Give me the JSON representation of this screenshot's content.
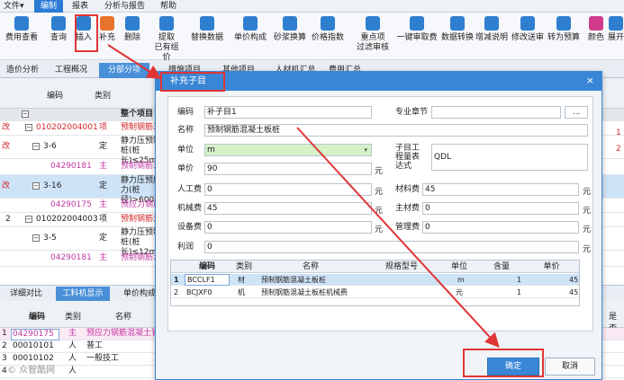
{
  "menubar": {
    "items": [
      "文件▾",
      "编制",
      "报表",
      "分析与报告",
      "帮助"
    ],
    "active_index": 1
  },
  "ribbon": {
    "tools": [
      {
        "label": "费用查看",
        "sub": "",
        "icon": "money-view-icon",
        "color": "#2f7fd0"
      },
      {
        "label": "查询",
        "sub": "",
        "icon": "search-icon",
        "color": "#2f7fd0"
      },
      {
        "label": "插入",
        "sub": "",
        "icon": "insert-icon",
        "color": "#2f7fd0"
      },
      {
        "label": "补充",
        "sub": "",
        "icon": "supplement-icon",
        "color": "#e8732a"
      },
      {
        "label": "删除",
        "sub": "",
        "icon": "delete-icon",
        "color": "#2f7fd0"
      },
      {
        "label": "提取",
        "sub": "已有组价",
        "icon": "extract-icon",
        "color": "#2f7fd0"
      },
      {
        "label": "替换数据",
        "sub": "",
        "icon": "replace-icon",
        "color": "#2f7fd0"
      },
      {
        "label": "单价构成",
        "sub": "",
        "icon": "price-icon",
        "color": "#2f7fd0"
      },
      {
        "label": "砂浆换算",
        "sub": "",
        "icon": "mortar-icon",
        "color": "#2f7fd0"
      },
      {
        "label": "价格指数",
        "sub": "",
        "icon": "index-icon",
        "color": "#2f7fd0"
      },
      {
        "label": "重点项",
        "sub": "过滤审核",
        "icon": "filter-icon",
        "color": "#2f7fd0"
      },
      {
        "label": "一键审取费",
        "sub": "",
        "icon": "fee-icon",
        "color": "#2f7fd0"
      },
      {
        "label": "数据转换",
        "sub": "",
        "icon": "convert-icon",
        "color": "#2f7fd0"
      },
      {
        "label": "增减说明",
        "sub": "",
        "icon": "note-icon",
        "color": "#2f7fd0"
      },
      {
        "label": "修改送审",
        "sub": "",
        "icon": "edit-icon",
        "color": "#2f7fd0"
      },
      {
        "label": "转为预算",
        "sub": "",
        "icon": "budget-icon",
        "color": "#2f7fd0"
      },
      {
        "label": "颜色",
        "sub": "",
        "icon": "color-icon",
        "color": "#d13c8a"
      },
      {
        "label": "展开",
        "sub": "",
        "icon": "expand-icon",
        "color": "#2f7fd0"
      }
    ]
  },
  "tabs": [
    "造价分析",
    "工程概况",
    "分部分项",
    "措施项目",
    "其他项目",
    "人材机汇总",
    "费用汇总"
  ],
  "grid": {
    "headers": [
      "编码",
      "类别"
    ],
    "rows": [
      {
        "mark": "",
        "code": "",
        "type": "",
        "name": "整个项目"
      },
      {
        "mark": "改",
        "code": "010202004001",
        "type": "项",
        "name": "预制钢筋混凝"
      },
      {
        "mark": "改",
        "code": "3-6",
        "type": "定",
        "name": "静力压预制桩(桩长)≤25m"
      },
      {
        "mark": "",
        "code": "04290181",
        "type": "主",
        "name": "预制钢筋混凝"
      },
      {
        "mark": "改",
        "code": "3-16",
        "type": "定",
        "name": "静力压预应力(桩径)>600"
      },
      {
        "mark": "",
        "code": "04290175",
        "type": "主",
        "name": "预应力钢筋混"
      },
      {
        "mark": "2",
        "code": "010202004003",
        "type": "项",
        "name": "预制钢筋混凝"
      },
      {
        "mark": "",
        "code": "3-5",
        "type": "定",
        "name": "静力压预制桩(桩长)≤12m"
      },
      {
        "mark": "",
        "code": "04290181",
        "type": "主",
        "name": "预制钢筋混凝"
      }
    ],
    "right_marks": [
      "1",
      "2"
    ]
  },
  "bottom_tabs": [
    "详细对比",
    "工料机显示",
    "单价构成"
  ],
  "bottom_grid": {
    "headers": [
      "编码",
      "类别",
      "名称",
      "是否"
    ],
    "rows": [
      {
        "idx": "1",
        "code": "04290175",
        "type": "主",
        "name": "预应力钢筋混凝土管桩"
      },
      {
        "idx": "2",
        "code": "00010101",
        "type": "人",
        "name": "普工"
      },
      {
        "idx": "3",
        "code": "00010102",
        "type": "人",
        "name": "一般技工"
      },
      {
        "idx": "4",
        "code": "",
        "type": "人",
        "name": ""
      }
    ]
  },
  "dialog": {
    "title": "补充子目",
    "close": "×",
    "fields": {
      "code_label": "编码",
      "code_value": "补子目1",
      "chapter_label": "专业章节",
      "chapter_value": "",
      "browse": "...",
      "name_label": "名称",
      "name_value": "预制钢筋混凝土板桩",
      "unit_label": "单位",
      "unit_value": "m",
      "qty_expr_label": "子目工程量表达式",
      "qty_expr_value": "QDL",
      "price_label": "单价",
      "price_value": "90",
      "yuan": "元",
      "labor_label": "人工费",
      "labor_value": "0",
      "material_label": "材料费",
      "material_value": "45",
      "machine_label": "机械费",
      "machine_value": "45",
      "main_label": "主材费",
      "main_value": "0",
      "equip_label": "设备费",
      "equip_value": "0",
      "mgmt_label": "管理费",
      "mgmt_value": "0",
      "profit_label": "利润",
      "profit_value": "0"
    },
    "grid": {
      "headers": [
        "编码",
        "类别",
        "名称",
        "规格型号",
        "单位",
        "含量",
        "单价"
      ],
      "rows": [
        {
          "idx": "1",
          "code": "BCCLF1",
          "type": "材",
          "name": "预制钢筋混凝土板桩",
          "spec": "",
          "unit": "m",
          "qty": "1",
          "price": "45"
        },
        {
          "idx": "2",
          "code": "BCJXF0",
          "type": "机",
          "name": "预制钢筋混凝土板桩机械费",
          "spec": "",
          "unit": "元",
          "qty": "1",
          "price": "45"
        }
      ]
    },
    "ok": "确定",
    "cancel": "取消"
  },
  "watermark": "© 众智酷网"
}
